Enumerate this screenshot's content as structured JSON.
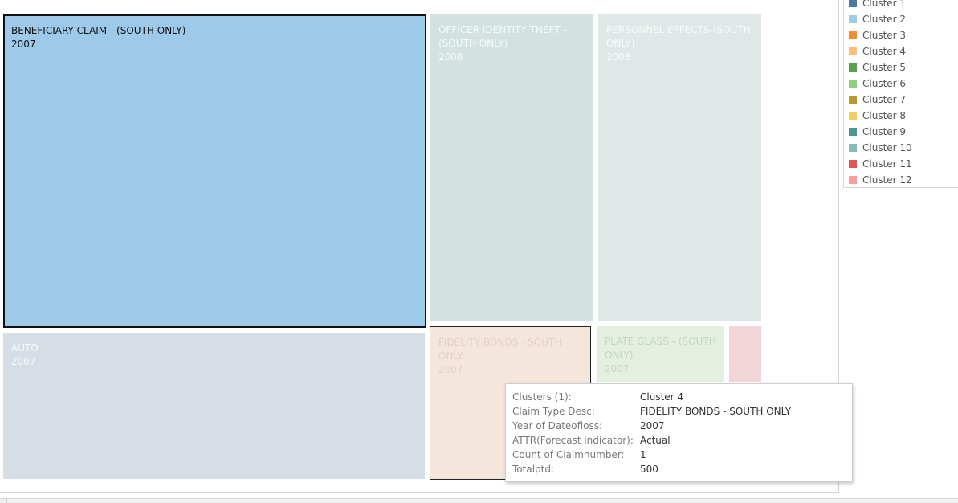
{
  "chart_data": {
    "type": "treemap",
    "tiles": [
      {
        "label": "BENEFICIARY CLAIM - (SOUTH ONLY)",
        "year": "2007",
        "cluster": "Cluster 2",
        "color": "#9ECAE9",
        "text_color": "#111111",
        "faded": false,
        "selected": true,
        "weight": 0.416
      },
      {
        "label": "OFFICER IDENTITY THEFT - (SOUTH ONLY)",
        "year": "2008",
        "cluster": "",
        "color": "#D3E1E1",
        "text_color": "#F6FAFA",
        "faded": true,
        "selected": false,
        "weight": 0.152
      },
      {
        "label": "PERSONNEL EFFECTS-(SOUTH ONLY)",
        "year": "2008",
        "cluster": "",
        "color": "#DFE8E7",
        "text_color": "#F7FAFA",
        "faded": true,
        "selected": false,
        "weight": 0.152
      },
      {
        "label": "AUTO",
        "year": "2007",
        "cluster": "",
        "color": "#D6DDE5",
        "text_color": "#F7F9FB",
        "faded": true,
        "selected": false,
        "weight": 0.168
      },
      {
        "label": "FIDELITY BONDS - SOUTH ONLY",
        "year": "2007",
        "cluster": "Cluster 4",
        "color": "#F5E6DC",
        "text_color": "#E2D0C5",
        "faded": true,
        "selected": false,
        "hovered": true,
        "weight": 0.059
      },
      {
        "label": "PLATE GLASS - (SOUTH ONLY)",
        "year": "2007",
        "cluster": "",
        "color": "#E4EFE0",
        "text_color": "#C4D6C0",
        "faded": true,
        "selected": false,
        "weight": 0.035
      },
      {
        "label": "",
        "year": "",
        "cluster": "",
        "color": "#F2D5D6",
        "text_color": "#F2D5D6",
        "faded": true,
        "selected": false,
        "weight": 0.01
      }
    ]
  },
  "legend": {
    "items": [
      {
        "label": "Cluster 1",
        "color": "#4E79A7"
      },
      {
        "label": "Cluster 2",
        "color": "#A0CBE8"
      },
      {
        "label": "Cluster 3",
        "color": "#F28E2B"
      },
      {
        "label": "Cluster 4",
        "color": "#FFBE7D"
      },
      {
        "label": "Cluster 5",
        "color": "#59A14F"
      },
      {
        "label": "Cluster 6",
        "color": "#8CD17D"
      },
      {
        "label": "Cluster 7",
        "color": "#B6992D"
      },
      {
        "label": "Cluster 8",
        "color": "#F1CE63"
      },
      {
        "label": "Cluster 9",
        "color": "#499894"
      },
      {
        "label": "Cluster 10",
        "color": "#86BCB6"
      },
      {
        "label": "Cluster 11",
        "color": "#E15759"
      },
      {
        "label": "Cluster 12",
        "color": "#FF9D9A"
      }
    ]
  },
  "tooltip": {
    "rows": [
      {
        "key": "Clusters (1):",
        "value": "Cluster 4"
      },
      {
        "key": "Claim Type Desc:",
        "value": "FIDELITY BONDS - SOUTH ONLY"
      },
      {
        "key": "Year of Dateofloss:",
        "value": "2007"
      },
      {
        "key": "ATTR(Forecast indicator):",
        "value": "Actual"
      },
      {
        "key": "Count of Claimnumber:",
        "value": "1"
      },
      {
        "key": "Totalptd:",
        "value": "500"
      }
    ]
  }
}
